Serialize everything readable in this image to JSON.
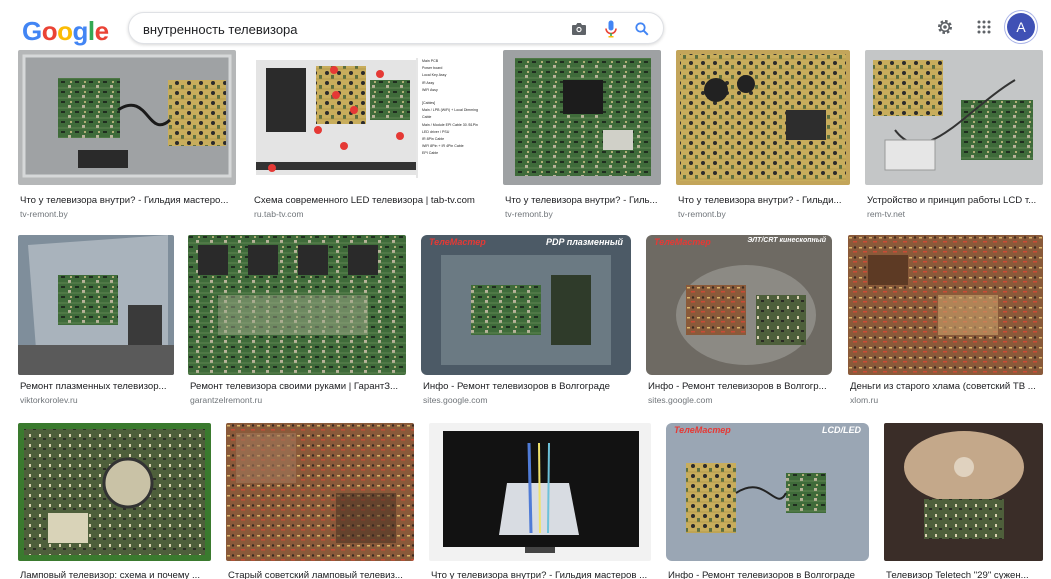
{
  "logo": {
    "letters": [
      "G",
      "o",
      "o",
      "g",
      "l",
      "e"
    ],
    "colors": [
      "#4285f4",
      "#ea4335",
      "#fbbc05",
      "#4285f4",
      "#34a853",
      "#ea4335"
    ]
  },
  "search": {
    "query": "внутренность телевизора",
    "camera_icon": "camera-icon",
    "mic_icon": "mic-icon",
    "search_icon": "search-icon"
  },
  "header": {
    "settings_icon": "gear-icon",
    "apps_icon": "apps-grid-icon",
    "avatar_letter": "A",
    "avatar_color": "#3f51b5"
  },
  "results": [
    {
      "title": "Что у телевизора внутри? - Гильдия мастеро...",
      "source": "tv-remont.by"
    },
    {
      "title": "Схема современного LED телевизора | tab-tv.com",
      "source": "ru.tab-tv.com"
    },
    {
      "title": "Что у телевизора внутри? - Гиль...",
      "source": "tv-remont.by"
    },
    {
      "title": "Что у телевизора внутри? - Гильди...",
      "source": "tv-remont.by"
    },
    {
      "title": "Устройство и принцип работы LCD т...",
      "source": "rem-tv.net"
    },
    {
      "title": "Ремонт плазменных телевизор...",
      "source": "viktorkorolev.ru"
    },
    {
      "title": "Ремонт телевизора своими руками | ГарантЗ...",
      "source": "garantzelremont.ru"
    },
    {
      "title": "Инфо - Ремонт телевизоров в Волгограде",
      "source": "sites.google.com"
    },
    {
      "title": "Инфо - Ремонт телевизоров в Волгогр...",
      "source": "sites.google.com"
    },
    {
      "title": "Деньги из старого хлама (советский ТВ ...",
      "source": "xlom.ru"
    },
    {
      "title": "Ламповый телевизор: схема и почему ...",
      "source": ""
    },
    {
      "title": "Старый советский ламповый телевиз...",
      "source": ""
    },
    {
      "title": "Что у телевизора внутри? - Гильдия мастеров ...",
      "source": ""
    },
    {
      "title": "Инфо - Ремонт телевизоров в Волгограде",
      "source": ""
    },
    {
      "title": "Телевизор Teletech \"29\" сужен...",
      "source": ""
    }
  ],
  "diagram_legend": {
    "items": [
      "Main PCB",
      "Power board",
      "Local Key Assy",
      "IR Assy",
      "WiFi Assy"
    ],
    "cables_heading": "[Cables]",
    "cables": [
      "Main / LPB (WiFi) + Local Dimming Cable",
      "Main / Module EPI Cable 30 /51Pin",
      "LED driver / PSU",
      "IR 8Pin Cable",
      "WiFi 8Pin + IR 4Pin Cable",
      "EPI Cable"
    ]
  },
  "badges": {
    "left_brand": "ТелеМастер",
    "plasma": "PDP плазменный",
    "crt": "ЭЛТ/CRT кинескопный",
    "lcd": "LCD/LED"
  }
}
